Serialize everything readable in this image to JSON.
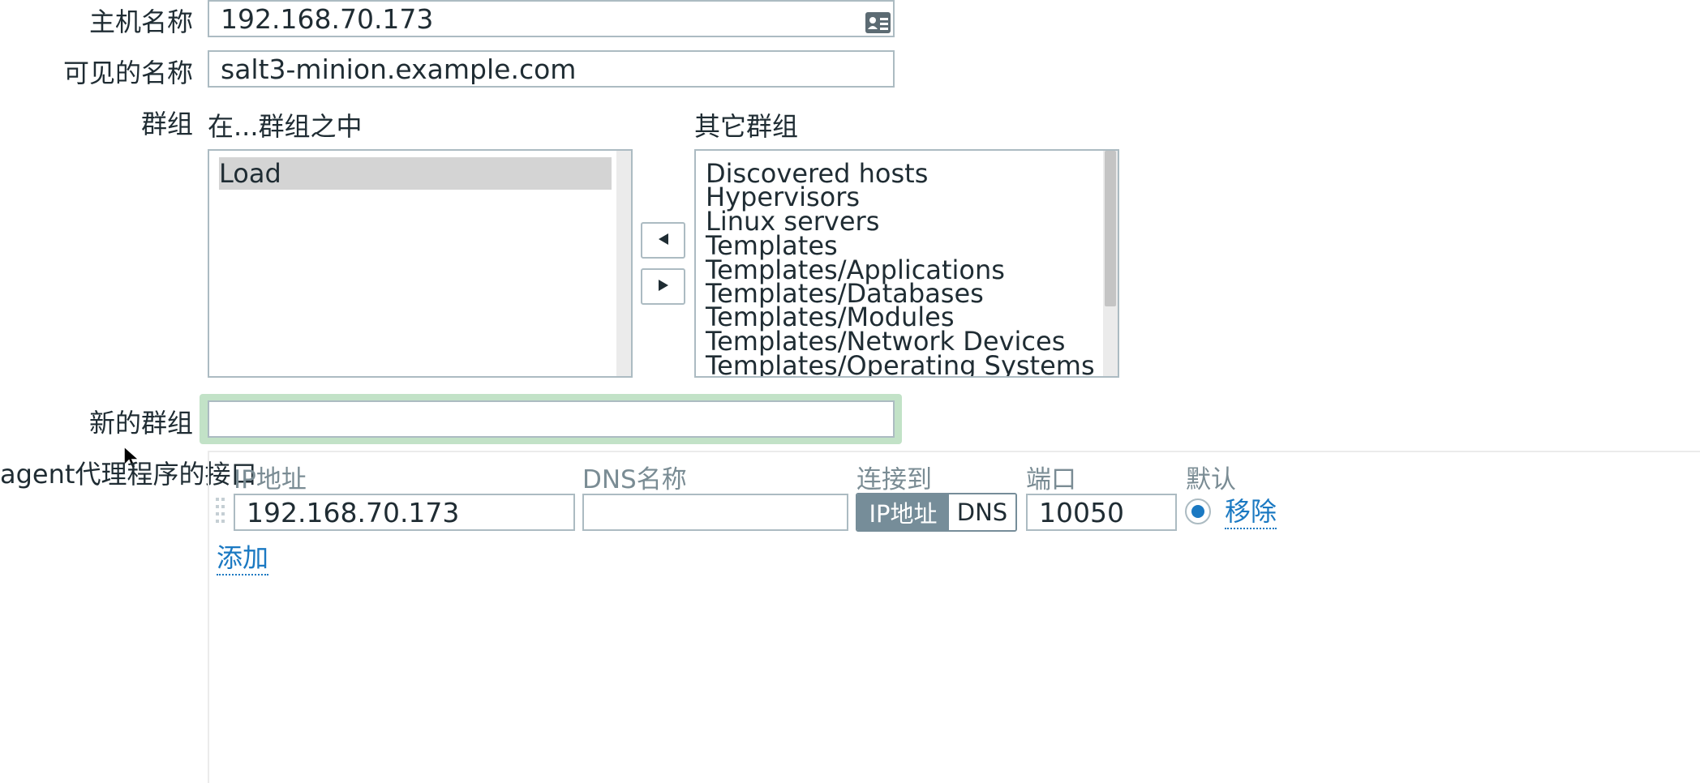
{
  "host": {
    "host_name_label": "主机名称",
    "host_name_value": "192.168.70.173",
    "host_name_icon": "id-card-icon",
    "visible_name_label": "可见的名称",
    "visible_name_value": "salt3-minion.example.com"
  },
  "groups": {
    "label": "群组",
    "in_groups_title": "在...群组之中",
    "other_groups_title": "其它群组",
    "in_groups": [
      "Load"
    ],
    "other_groups": [
      "Discovered hosts",
      "Hypervisors",
      "Linux servers",
      "Templates",
      "Templates/Applications",
      "Templates/Databases",
      "Templates/Modules",
      "Templates/Network Devices",
      "Templates/Operating Systems"
    ],
    "move_left_icon": "triangle-left-icon",
    "move_right_icon": "triangle-right-icon",
    "new_group_label": "新的群组",
    "new_group_value": ""
  },
  "interfaces": {
    "label": "agent代理程序的接口",
    "columns": {
      "ip": "IP地址",
      "dns": "DNS名称",
      "connect_to": "连接到",
      "port": "端口",
      "default": "默认"
    },
    "row": {
      "ip": "192.168.70.173",
      "dns": "",
      "connect_ip_label": "IP地址",
      "connect_dns_label": "DNS",
      "connect_selected": "IP地址",
      "port": "10050",
      "default_selected": true,
      "remove_label": "移除",
      "drag_handle_icon": "drag-handle-icon"
    },
    "add_label": "添加"
  },
  "colors": {
    "accent": "#1b79c2",
    "border": "#acbbc2",
    "toggle_active": "#768d99",
    "new_group_highlight": "#c2e2c7",
    "selected_item": "#d4d4d4"
  }
}
